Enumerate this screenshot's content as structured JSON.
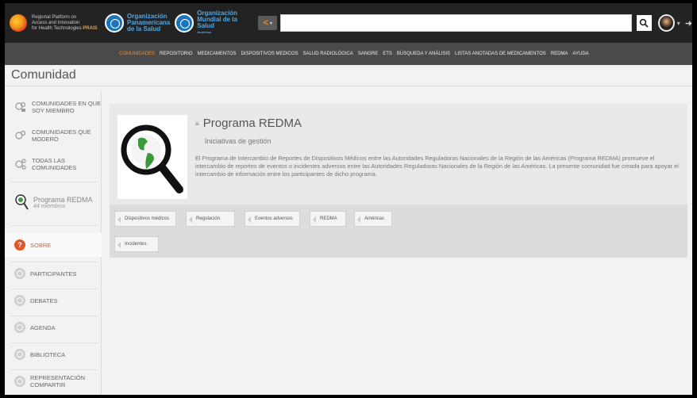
{
  "header": {
    "brand_lines": [
      "Regional Platform on",
      "Access and Innovation",
      "for Health Technologies"
    ],
    "brand_plus": "PRAIS",
    "paho_name": [
      "Organización",
      "Panamericana",
      "de la Salud"
    ],
    "who_name": [
      "Organización",
      "Mundial de la Salud"
    ],
    "who_sub": "Américas",
    "search_placeholder": ""
  },
  "nav": {
    "items": [
      "COMUNIDADES",
      "REPOSITORIO",
      "MEDICAMENTOS",
      "DISPOSITIVOS MEDICOS",
      "SALUD RADIOLÓGICA",
      "SANGRE",
      "ETS",
      "BÚSQUEDA Y ANÁLISIS",
      "LISTAS ANOTADAS DE MEDICAMENTOS",
      "REDMA",
      "AYUDA"
    ],
    "active": "COMUNIDADES"
  },
  "page": {
    "title": "Comunidad"
  },
  "sidebar": {
    "links": [
      "COMUNIDADES EN QUE SOY MIEMBRO",
      "COMUNIDADES QUE MODERO",
      "TODAS LAS COMUNIDADES"
    ],
    "community": {
      "name": "Programa REDMA",
      "members": "44 miembros"
    },
    "sections": [
      "SOBRE",
      "PARTICIPANTES",
      "DEBATES",
      "AGENDA",
      "BIBLIOTECA",
      "REPRESENTACIÓN COMPARTIR"
    ]
  },
  "card": {
    "title": "Programa REDMA",
    "subtitle": "Iniciativas de gestión",
    "description": "El Programa de Intercambio de Reportes de Dispositivos Médicos entre las Autoridades Reguladoras Nacionales de la Región de las Américas (Programa REDMA) promueve el intercambio de reportes de eventos o incidentes adversos entre las Autoridades Reguladoras Nacionales de la Región de las Américas. La presente comunidad fue creada para apoyar el intercambio de información entre los participantes de dicho programa.",
    "tags": [
      "Dispositivos médicos",
      "Regulación",
      "Eventos adversos",
      "REDMA",
      "Américas",
      "Incidentes."
    ]
  },
  "colors": {
    "accent": "#e2572a",
    "nav_active": "#f08a2b",
    "topbar": "#232323",
    "navbar": "#4a4a4a"
  }
}
